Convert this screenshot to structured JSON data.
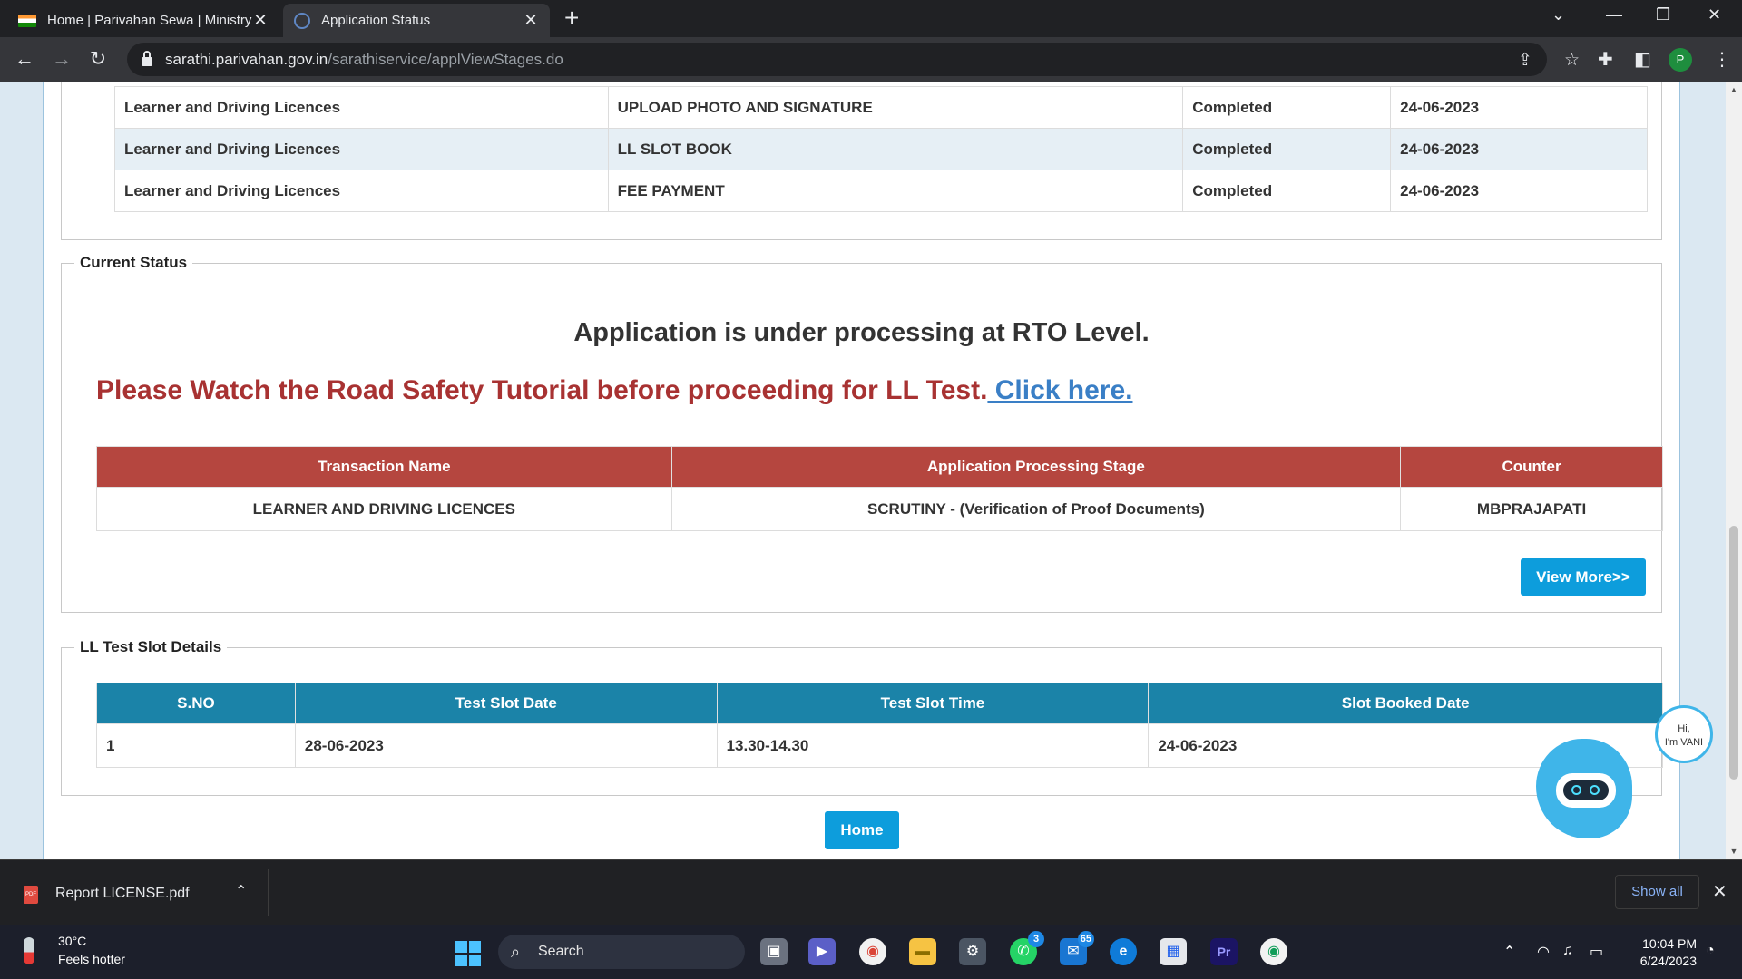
{
  "browser": {
    "tabs": [
      {
        "title": "Home | Parivahan Sewa | Ministry",
        "active": false
      },
      {
        "title": "Application Status",
        "active": true
      }
    ],
    "url_host": "sarathi.parivahan.gov.in",
    "url_path": "/sarathiservice/applViewStages.do",
    "profile_initial": "P"
  },
  "stages": [
    {
      "transaction": "Learner and Driving Licences",
      "stage": "UPLOAD PHOTO AND SIGNATURE",
      "status": "Completed",
      "date": "24-06-2023"
    },
    {
      "transaction": "Learner and Driving Licences",
      "stage": "LL SLOT BOOK",
      "status": "Completed",
      "date": "24-06-2023"
    },
    {
      "transaction": "Learner and Driving Licences",
      "stage": "FEE PAYMENT",
      "status": "Completed",
      "date": "24-06-2023"
    }
  ],
  "current_status": {
    "legend": "Current Status",
    "message": "Application is under processing at RTO Level.",
    "tutorial_text": "Please Watch the Road Safety Tutorial before proceeding for LL Test.",
    "tutorial_link": " Click here.",
    "headers": [
      "Transaction Name",
      "Application Processing Stage",
      "Counter"
    ],
    "row": [
      "LEARNER AND DRIVING LICENCES",
      "SCRUTINY - (Verification of Proof Documents)",
      "MBPRAJAPATI"
    ],
    "view_more": "View More>>"
  },
  "slot_details": {
    "legend": "LL Test Slot Details",
    "headers": [
      "S.NO",
      "Test Slot Date",
      "Test Slot Time",
      "Slot Booked Date"
    ],
    "row": [
      "1",
      "28-06-2023",
      "13.30-14.30",
      "24-06-2023"
    ]
  },
  "home_button": "Home",
  "chatbot": {
    "greeting_line1": "Hi,",
    "greeting_line2": "I'm VANI"
  },
  "download": {
    "file": "Report LICENSE.pdf",
    "show_all": "Show all",
    "pdf_label": "PDF"
  },
  "taskbar": {
    "temperature": "30°C",
    "weather": "Feels hotter",
    "search": "Search",
    "whatsapp_badge": "3",
    "mail_badge": "65",
    "time": "10:04 PM",
    "date": "6/24/2023"
  }
}
